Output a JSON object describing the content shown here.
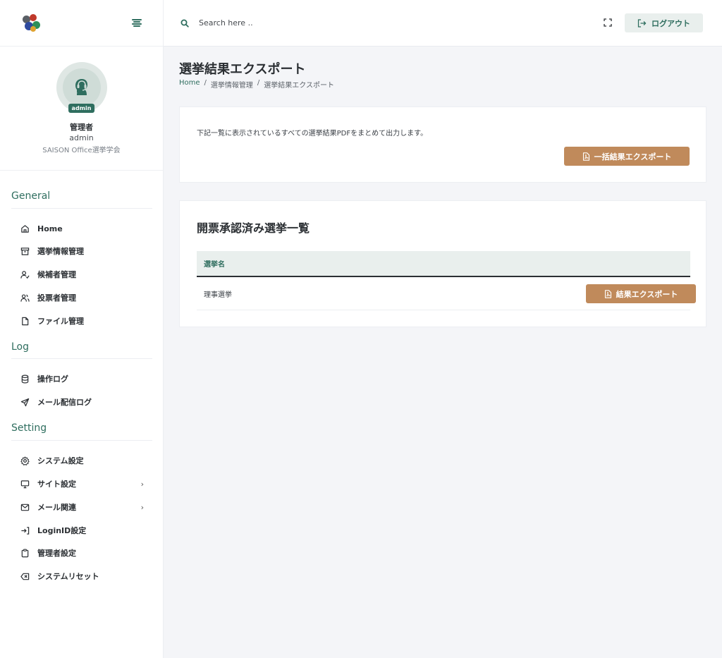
{
  "header": {
    "search_placeholder": "Search here ..",
    "logout_label": "ログアウト"
  },
  "profile": {
    "role_badge": "admin",
    "name": "管理者",
    "username": "admin",
    "organization": "SAISON Office選挙学会"
  },
  "sidebar": {
    "sections": [
      {
        "title": "General",
        "items": [
          {
            "label": "Home",
            "icon": "home-icon"
          },
          {
            "label": "選挙情報管理",
            "icon": "archive-icon"
          },
          {
            "label": "候補者管理",
            "icon": "user-check-icon"
          },
          {
            "label": "投票者管理",
            "icon": "users-icon"
          },
          {
            "label": "ファイル管理",
            "icon": "file-icon"
          }
        ]
      },
      {
        "title": "Log",
        "items": [
          {
            "label": "操作ログ",
            "icon": "database-icon"
          },
          {
            "label": "メール配信ログ",
            "icon": "send-icon"
          }
        ]
      },
      {
        "title": "Setting",
        "items": [
          {
            "label": "システム設定",
            "icon": "gear-icon"
          },
          {
            "label": "サイト設定",
            "icon": "monitor-icon"
          },
          {
            "label": "メール関連",
            "icon": "mail-icon"
          },
          {
            "label": "LoginID設定",
            "icon": "login-icon"
          },
          {
            "label": "管理者設定",
            "icon": "clipboard-icon"
          },
          {
            "label": "システムリセット",
            "icon": "backspace-icon"
          }
        ]
      }
    ]
  },
  "page": {
    "title": "選挙結果エクスポート",
    "breadcrumb": [
      "Home",
      "選挙情報管理",
      "選挙結果エクスポート"
    ],
    "breadcrumb_sep": "/"
  },
  "export_card": {
    "description": "下記一覧に表示されているすべての選挙結果PDFをまとめて出力します。",
    "bulk_button": "一括結果エクスポート"
  },
  "list_card": {
    "title": "開票承認済み選挙一覧",
    "column_header": "選挙名",
    "rows": [
      {
        "name": "理事選挙",
        "button": "結果エクスポート"
      }
    ]
  },
  "colors": {
    "accent": "#2f6e5f",
    "button_brown": "#c08a5b",
    "background": "#f4f5f8"
  }
}
